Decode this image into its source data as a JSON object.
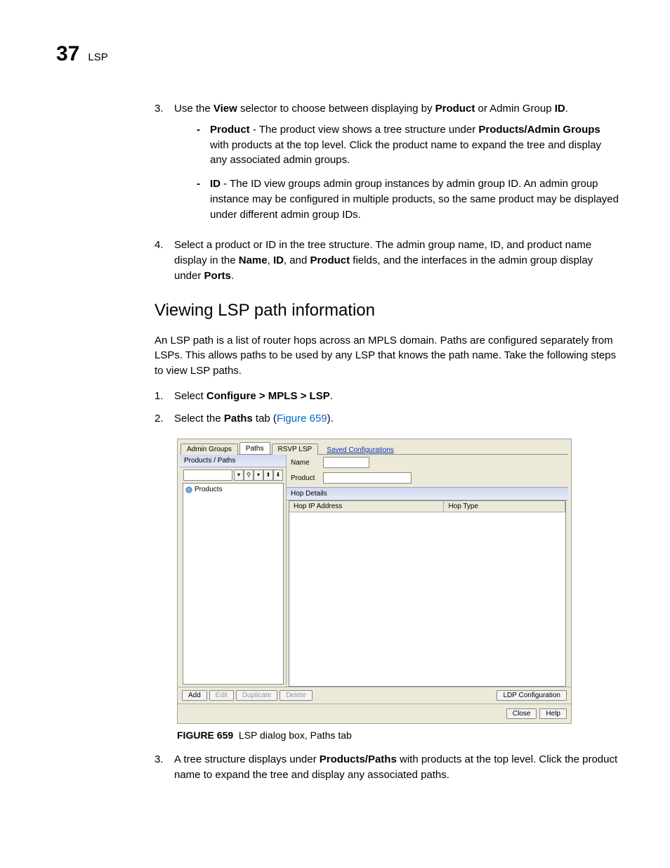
{
  "header": {
    "chapter_number": "37",
    "chapter_label": "LSP"
  },
  "step3": {
    "marker": "3.",
    "text_a": "Use the ",
    "bold_view": "View",
    "text_b": " selector to choose between displaying by ",
    "bold_product": "Product",
    "text_c": " or Admin Group ",
    "bold_id": "ID",
    "text_d": "."
  },
  "bullet_product": {
    "marker": "-",
    "bold": "Product",
    "text_a": " - The product view shows a tree structure under ",
    "bold_pag": "Products/Admin Groups",
    "text_b": " with products at the top level. Click the product name to expand the tree and display any associated admin groups."
  },
  "bullet_id": {
    "marker": "-",
    "bold": "ID",
    "text": " - The ID view groups admin group instances by admin group ID. An admin group instance may be configured in multiple products, so the same product may be displayed under different admin group IDs."
  },
  "step4": {
    "marker": "4.",
    "text_a": "Select a product or ID in the tree structure. The admin group name, ID, and product name display in the ",
    "bold_name": "Name",
    "text_b": ", ",
    "bold_id": "ID",
    "text_c": ", and ",
    "bold_product": "Product",
    "text_d": " fields, and the interfaces in the admin group display under ",
    "bold_ports": "Ports",
    "text_e": "."
  },
  "heading": "Viewing LSP path information",
  "intro": "An LSP path is a list of router hops across an MPLS domain. Paths are configured separately from LSPs. This allows paths to be used by any LSP that knows the path name. Take the following steps to view LSP paths.",
  "p_step1": {
    "marker": "1.",
    "text_a": "Select ",
    "bold": "Configure > MPLS > LSP",
    "text_b": "."
  },
  "p_step2": {
    "marker": "2.",
    "text_a": "Select the ",
    "bold": "Paths",
    "text_b": " tab (",
    "link": "Figure 659",
    "text_c": ")."
  },
  "figure": {
    "tabs": {
      "admin_groups": "Admin Groups",
      "paths": "Paths",
      "rsvp_lsp": "RSVP LSP",
      "saved": "Saved Configurations"
    },
    "left": {
      "title": "Products / Paths",
      "tree_root": "Products"
    },
    "toolbar": {
      "dropdown": "▾",
      "filter": "⚲",
      "dropdown2": "▾",
      "up": "⬆",
      "down": "⬇"
    },
    "right": {
      "name_label": "Name",
      "product_label": "Product",
      "hop_details": "Hop Details",
      "col_ip": "Hop IP Address",
      "col_type": "Hop Type"
    },
    "buttons": {
      "add": "Add",
      "edit": "Edit",
      "duplicate": "Duplicate",
      "delete": "Delete",
      "ldp": "LDP Configuration",
      "close": "Close",
      "help": "Help"
    },
    "caption_label": "FIGURE 659",
    "caption_text": "LSP dialog box, Paths tab"
  },
  "p_step3": {
    "marker": "3.",
    "text_a": "A tree structure displays under ",
    "bold": "Products/Paths",
    "text_b": " with products at the top level. Click the product name to expand the tree and display any associated paths."
  }
}
